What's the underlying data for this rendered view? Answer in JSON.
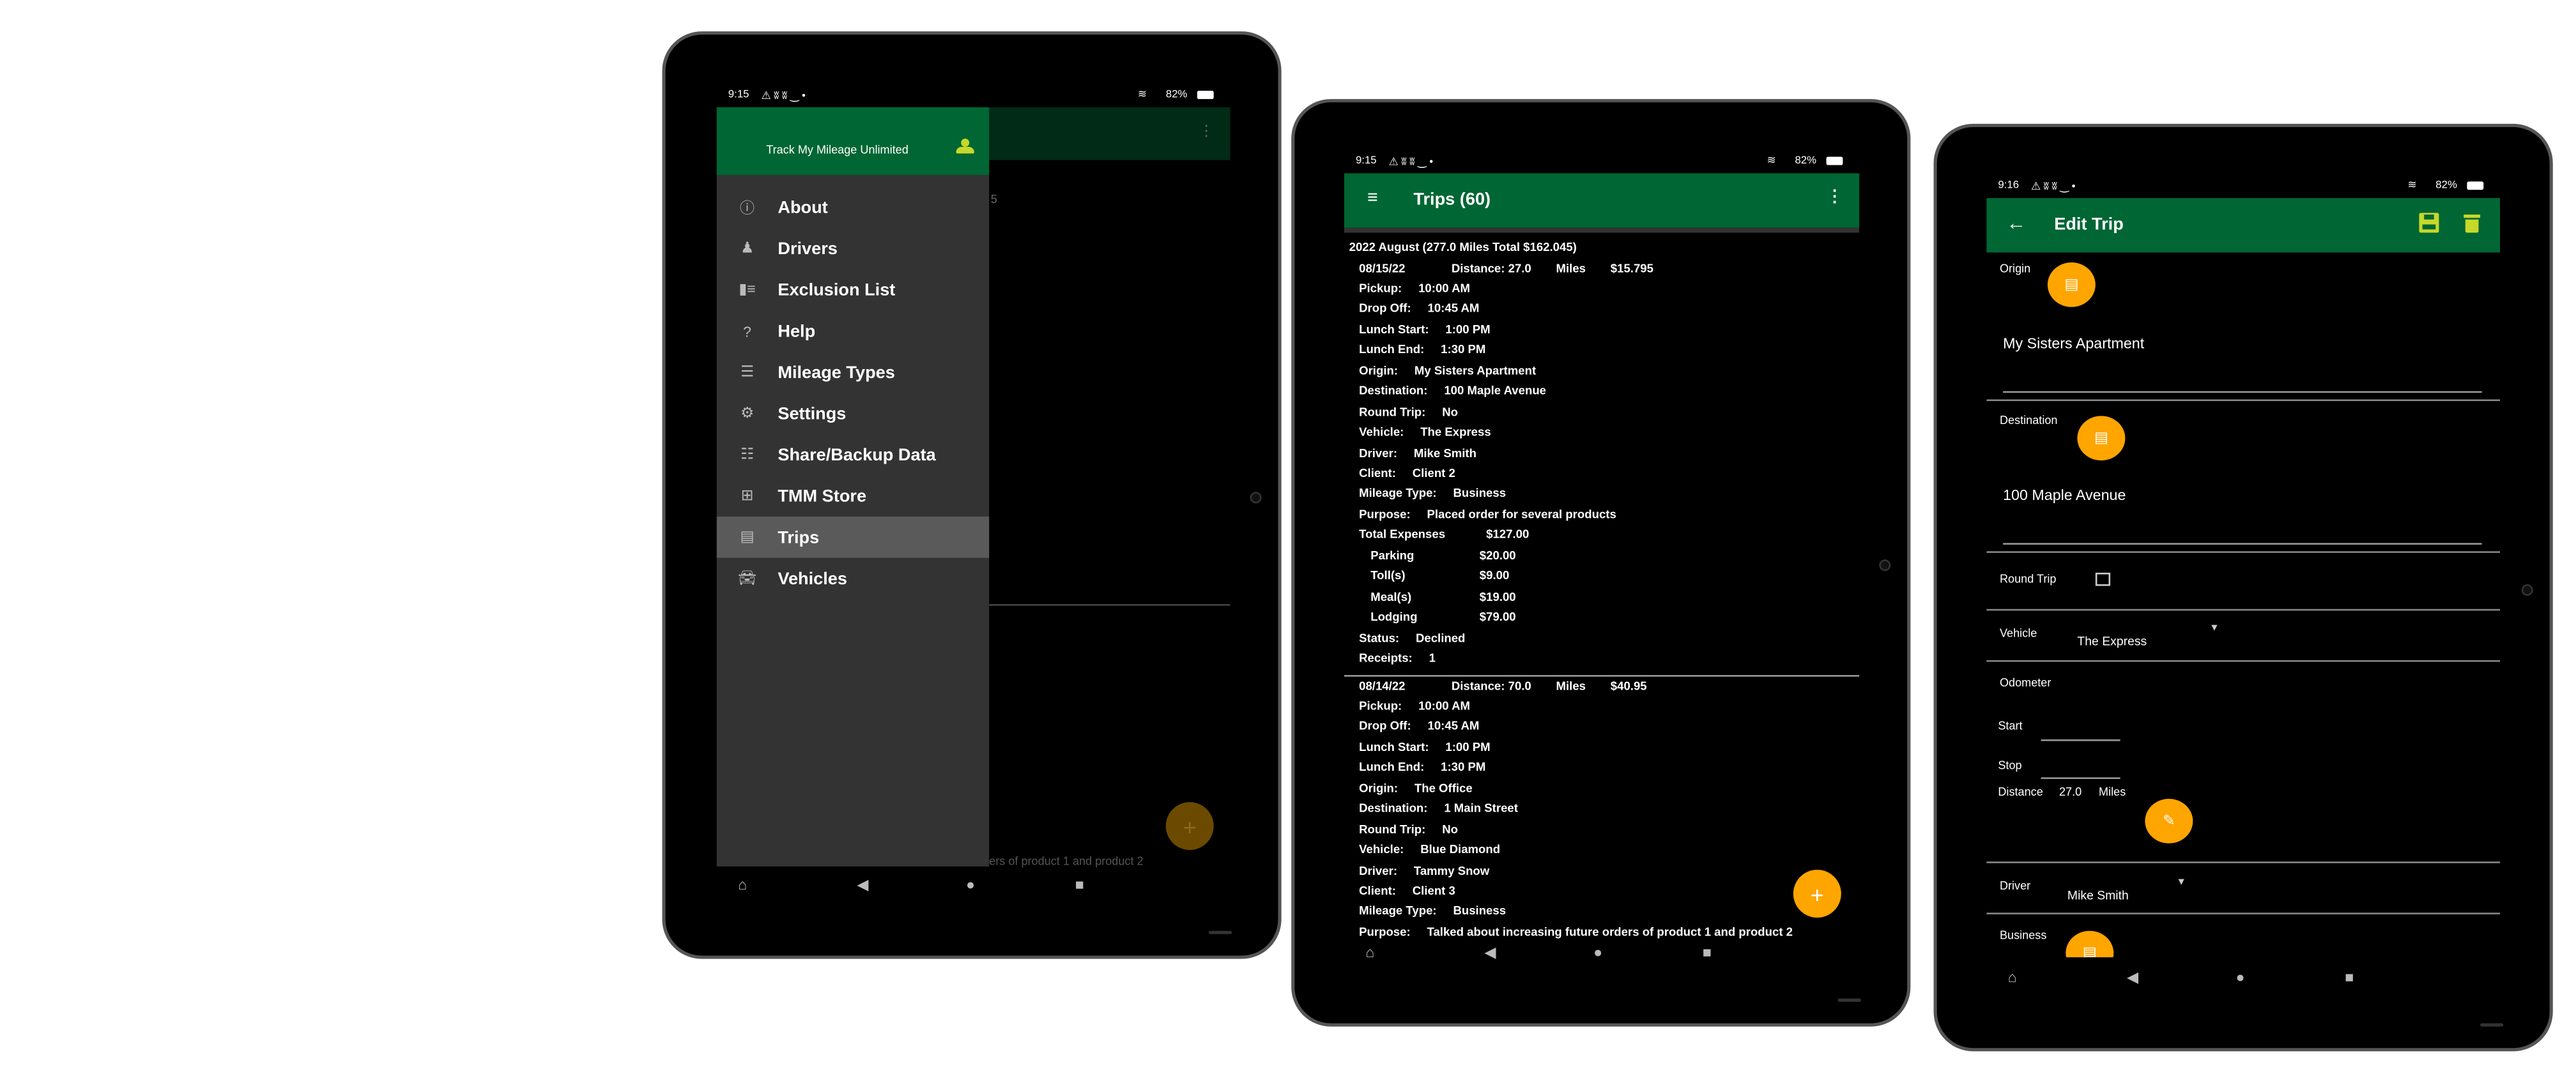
{
  "status": {
    "time1": "9:15",
    "time2": "9:15",
    "time3": "9:16",
    "battery": "82%",
    "icons": [
      "warning-icon",
      "notification-icon",
      "notification-icon",
      "amazon-icon",
      "dot-icon",
      "wifi-icon",
      "battery-charging-icon"
    ]
  },
  "nav_icons": [
    "assistant-icon",
    "back-icon",
    "home-icon",
    "recents-icon"
  ],
  "colors": {
    "appbar": "#006633",
    "fab": "#ffa500",
    "accent_icon": "#c6d82a",
    "drawer": "#333333",
    "selected": "#5a5a5a"
  },
  "drawer": {
    "header_title": "Track My Mileage Unlimited",
    "items": [
      {
        "label": "About",
        "icon": "info-icon"
      },
      {
        "label": "Drivers",
        "icon": "driver-icon"
      },
      {
        "label": "Exclusion List",
        "icon": "exclusion-list-icon"
      },
      {
        "label": "Help",
        "icon": "help-icon"
      },
      {
        "label": "Mileage Types",
        "icon": "list-icon"
      },
      {
        "label": "Settings",
        "icon": "settings-icon"
      },
      {
        "label": "Share/Backup Data",
        "icon": "share-backup-icon"
      },
      {
        "label": "TMM Store",
        "icon": "store-icon"
      },
      {
        "label": "Trips",
        "icon": "clipboard-icon",
        "selected": true
      },
      {
        "label": "Vehicles",
        "icon": "car-icon"
      }
    ],
    "behind_fragment": "5",
    "behind_footer": "ers of product 1 and product 2"
  },
  "trips": {
    "title": "Trips (60)",
    "group_header": "2022 August (277.0 Miles Total $162.045)",
    "trip1": {
      "date": "08/15/22",
      "distance": "Distance: 27.0",
      "miles": "Miles",
      "amount": "$15.795",
      "rows": [
        [
          "Pickup:",
          "10:00 AM"
        ],
        [
          "Drop Off:",
          "10:45 AM"
        ],
        [
          "Lunch Start:",
          "1:00 PM"
        ],
        [
          "Lunch End:",
          "1:30 PM"
        ],
        [
          "Origin:",
          "My Sisters Apartment"
        ],
        [
          "Destination:",
          "100 Maple Avenue"
        ],
        [
          "Round Trip:",
          "No"
        ],
        [
          "Vehicle:",
          "The Express"
        ],
        [
          "Driver:",
          "Mike Smith"
        ],
        [
          "Client:",
          "Client 2"
        ],
        [
          "Mileage Type:",
          "Business"
        ],
        [
          "Purpose:",
          "Placed order for several products"
        ]
      ],
      "total_expenses_label": "Total Expenses",
      "total_expenses": "$127.00",
      "expenses": [
        [
          "Parking",
          "$20.00"
        ],
        [
          "Toll(s)",
          "$9.00"
        ],
        [
          "Meal(s)",
          "$19.00"
        ],
        [
          "Lodging",
          "$79.00"
        ]
      ],
      "tail": [
        [
          "Status:",
          "Declined"
        ],
        [
          "Receipts:",
          "1"
        ]
      ]
    },
    "trip2": {
      "date": "08/14/22",
      "distance": "Distance: 70.0",
      "miles": "Miles",
      "amount": "$40.95",
      "rows": [
        [
          "Pickup:",
          "10:00 AM"
        ],
        [
          "Drop Off:",
          "10:45 AM"
        ],
        [
          "Lunch Start:",
          "1:00 PM"
        ],
        [
          "Lunch End:",
          "1:30 PM"
        ],
        [
          "Origin:",
          "The Office"
        ],
        [
          "Destination:",
          "1 Main Street"
        ],
        [
          "Round Trip:",
          "No"
        ],
        [
          "Vehicle:",
          "Blue Diamond"
        ],
        [
          "Driver:",
          "Tammy Snow"
        ],
        [
          "Client:",
          "Client 3"
        ],
        [
          "Mileage Type:",
          "Business"
        ],
        [
          "Purpose:",
          "Talked about increasing future orders of product 1 and product 2"
        ]
      ]
    }
  },
  "edit": {
    "title": "Edit Trip",
    "origin_label": "Origin",
    "origin_value": "My Sisters Apartment",
    "destination_label": "Destination",
    "destination_value": "100 Maple Avenue",
    "round_trip_label": "Round Trip",
    "round_trip_checked": false,
    "vehicle_label": "Vehicle",
    "vehicle_value": "The Express",
    "odometer_label": "Odometer",
    "start_label": "Start",
    "stop_label": "Stop",
    "distance_label": "Distance",
    "distance_value": "27.0",
    "distance_unit": "Miles",
    "driver_label": "Driver",
    "driver_value": "Mike Smith",
    "business_label": "Business"
  }
}
